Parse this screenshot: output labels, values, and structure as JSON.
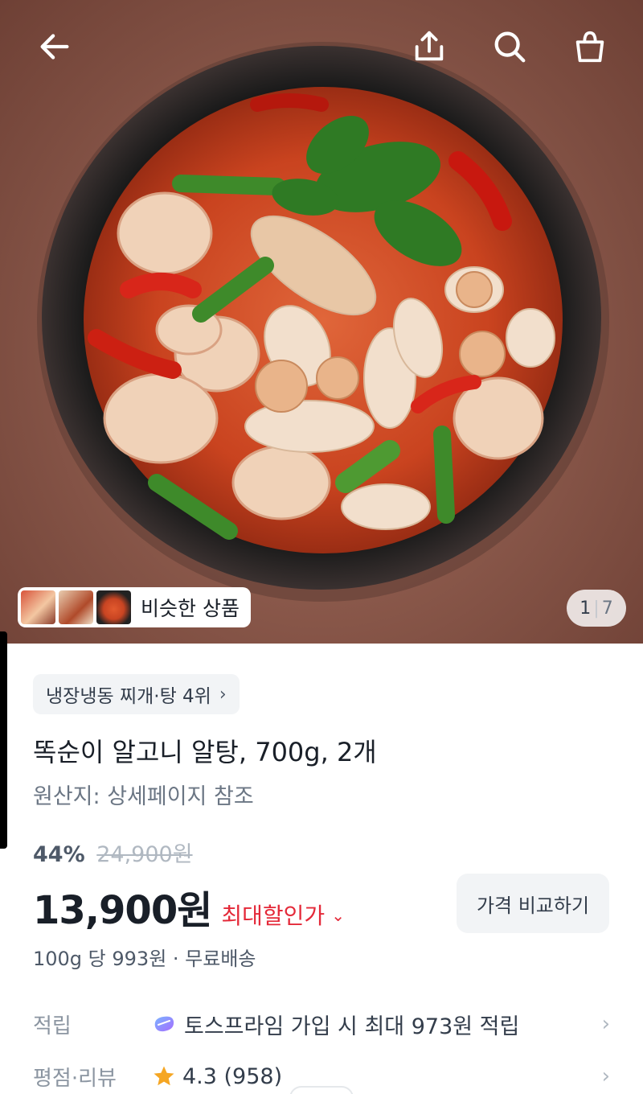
{
  "topbar": {
    "back_icon": "arrow-left-icon",
    "share_icon": "share-icon",
    "search_icon": "search-icon",
    "cart_icon": "shopping-bag-icon"
  },
  "hero": {
    "similar_label": "비슷한 상품",
    "counter_current": "1",
    "counter_separator": "|",
    "counter_total": "7"
  },
  "product": {
    "rank_label": "냉장냉동 찌개·탕 4위",
    "rank_chevron": "›",
    "title": "똑순이 알고니 알탕, 700g, 2개",
    "origin": "원산지: 상세페이지 참조",
    "discount_pct": "44%",
    "original_price": "24,900원",
    "price": "13,900원",
    "best_price_label": "최대할인가",
    "best_price_caret": "⌄",
    "compare_button": "가격 비교하기",
    "unit_price": "100g 당 993원 · 무료배송"
  },
  "info": {
    "points_label": "적립",
    "points_value": "토스프라임 가입 시 최대 973원 적립",
    "rating_label": "평점·리뷰",
    "rating_value": "4.3 (958)",
    "arrow": "›"
  },
  "colors": {
    "accent_red": "#e42939",
    "text_primary": "#191f28",
    "text_secondary": "#6b7684",
    "chip_bg": "#f2f4f6",
    "star": "#f5a623"
  }
}
